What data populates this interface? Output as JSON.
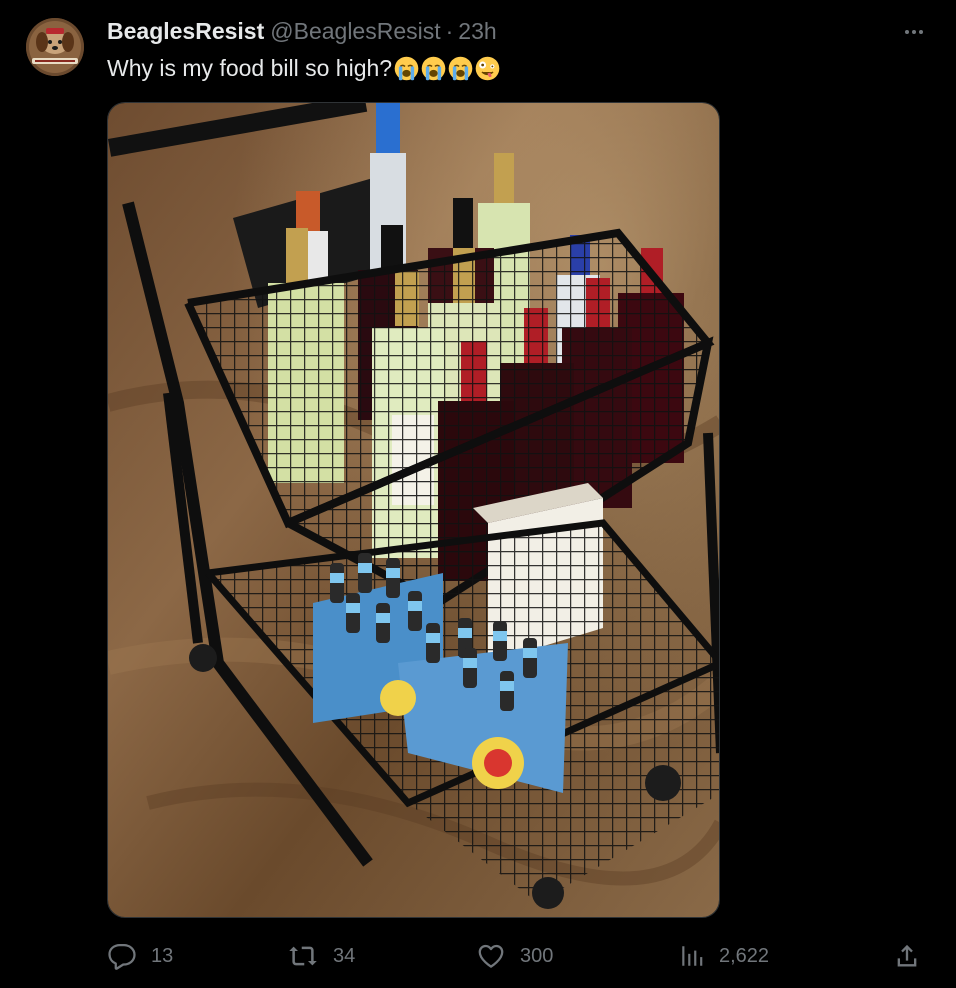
{
  "author": {
    "display_name": "BeaglesResist",
    "handle": "@BeaglesResist",
    "separator": "·",
    "time": "23h",
    "avatar_icon": "avatar-beagle-badge"
  },
  "tweet": {
    "text": "Why is my food bill so high?",
    "emojis": [
      "loudly-crying-face",
      "loudly-crying-face",
      "loudly-crying-face",
      "zany-face"
    ]
  },
  "media": {
    "type": "photo",
    "subject": "shopping-cart-with-wine-and-beer"
  },
  "actions": {
    "replies": "13",
    "reposts": "34",
    "likes": "300",
    "views": "2,622"
  },
  "colors": {
    "background": "#000000",
    "primary_text": "#e7e9ea",
    "secondary_text": "#71767b",
    "border": "#2f3336"
  }
}
